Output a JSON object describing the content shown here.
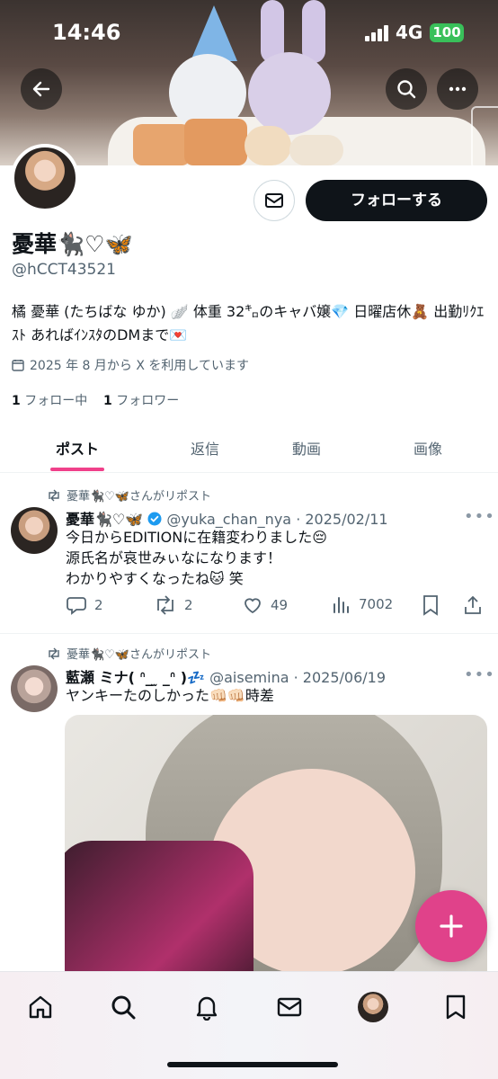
{
  "status_bar": {
    "time": "14:46",
    "network": "4G",
    "battery": "100"
  },
  "profile": {
    "display_name": "憂華🐈‍⬛♡🦋",
    "handle": "@hCCT43521",
    "bio": "橘 憂華 (たちばな ゆか) 🪽 体重 32㌔のキャバ嬢💎 日曜店休🧸 出勤ﾘｸｴｽﾄ あればｲﾝｽﾀのDMまで💌",
    "joined": "2025 年 8 月から X を利用しています",
    "following_count": "1",
    "following_label": "フォロー中",
    "followers_count": "1",
    "followers_label": "フォロワー",
    "follow_button": "フォローする"
  },
  "tabs": [
    "ポスト",
    "返信",
    "動画",
    "画像"
  ],
  "posts": [
    {
      "repost_label": "憂華🐈‍⬛♡🦋さんがリポスト",
      "author_name": "憂華🐈‍⬛♡🦋",
      "verified": true,
      "author_handle": "@yuka_chan_nya",
      "date": "· 2025/02/11",
      "lines": [
        "今日からEDITIONに在籍変わりました😔",
        "源氏名が哀世みぃなになります！",
        "わかりやすくなったね🐱 笑"
      ],
      "replies": "2",
      "reposts": "2",
      "likes": "49",
      "views": "7002"
    },
    {
      "repost_label": "憂華🐈‍⬛♡🦋さんがリポスト",
      "author_name": "藍瀬 ミナ( ᐢ_ ̫ _ᐢ )💤",
      "author_handle": "@aisemina",
      "date": "· 2025/06/19",
      "lines": [
        "ヤンキーたのしかった👊🏻👊🏻時差"
      ]
    }
  ],
  "icons": {
    "back": "arrow-left-icon",
    "search": "search-icon",
    "more": "more-icon",
    "mail": "mail-icon",
    "compose": "plus-icon",
    "nav": [
      "home-icon",
      "search-icon",
      "bell-icon",
      "mail-icon",
      "profile-avatar",
      "bookmark-icon"
    ]
  },
  "colors": {
    "accent": "#e0428a",
    "text": "#0f1419",
    "secondary": "#536471",
    "follow_bg": "#0f1419",
    "verified": "#1d9bf0"
  }
}
